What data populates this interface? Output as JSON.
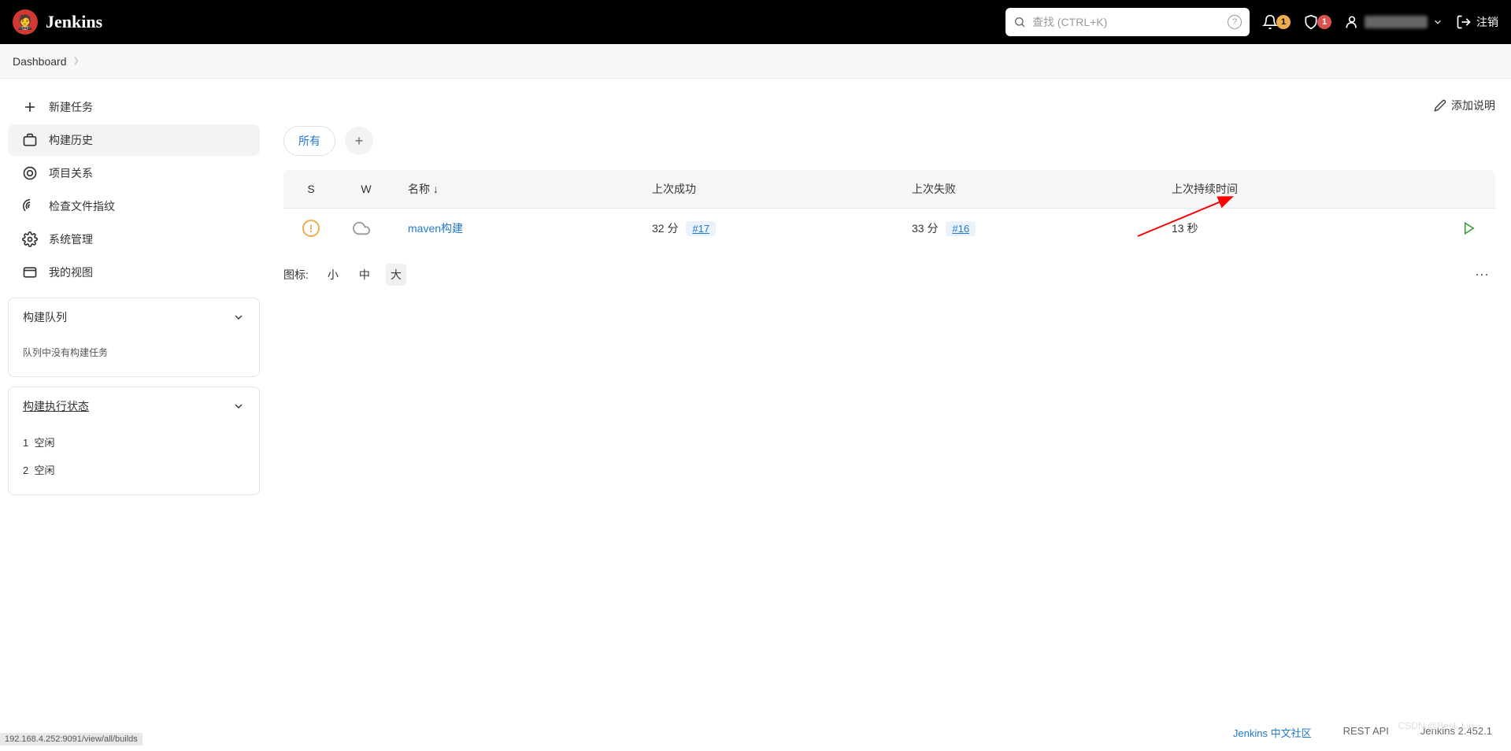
{
  "header": {
    "logo_text": "Jenkins",
    "search_placeholder": "查找 (CTRL+K)",
    "bell_badge": "1",
    "shield_badge": "1",
    "logout_label": "注销"
  },
  "breadcrumb": {
    "item": "Dashboard"
  },
  "sidebar": {
    "items": [
      {
        "label": "新建任务"
      },
      {
        "label": "构建历史"
      },
      {
        "label": "项目关系"
      },
      {
        "label": "检查文件指纹"
      },
      {
        "label": "系统管理"
      },
      {
        "label": "我的视图"
      }
    ]
  },
  "panels": {
    "queue": {
      "title": "构建队列",
      "empty_text": "队列中没有构建任务"
    },
    "executors": {
      "title": "构建执行状态",
      "rows": [
        {
          "num": "1",
          "state": "空闲"
        },
        {
          "num": "2",
          "state": "空闲"
        }
      ]
    }
  },
  "content": {
    "add_description": "添加说明",
    "tabs": {
      "all": "所有"
    },
    "table": {
      "headers": {
        "s": "S",
        "w": "W",
        "name": "名称 ↓",
        "last_success": "上次成功",
        "last_failure": "上次失败",
        "last_duration": "上次持续时间"
      },
      "rows": [
        {
          "name": "maven构建",
          "last_success_time": "32 分",
          "last_success_build": "#17",
          "last_failure_time": "33 分",
          "last_failure_build": "#16",
          "duration": "13 秒"
        }
      ]
    },
    "icon_size": {
      "label": "图标:",
      "small": "小",
      "medium": "中",
      "large": "大"
    }
  },
  "footer": {
    "community": "Jenkins 中文社区",
    "rest_api": "REST API",
    "version": "Jenkins 2.452.1"
  },
  "status_bar": "192.168.4.252:9091/view/all/builds",
  "watermark": "CSDN @Best_Liu~"
}
